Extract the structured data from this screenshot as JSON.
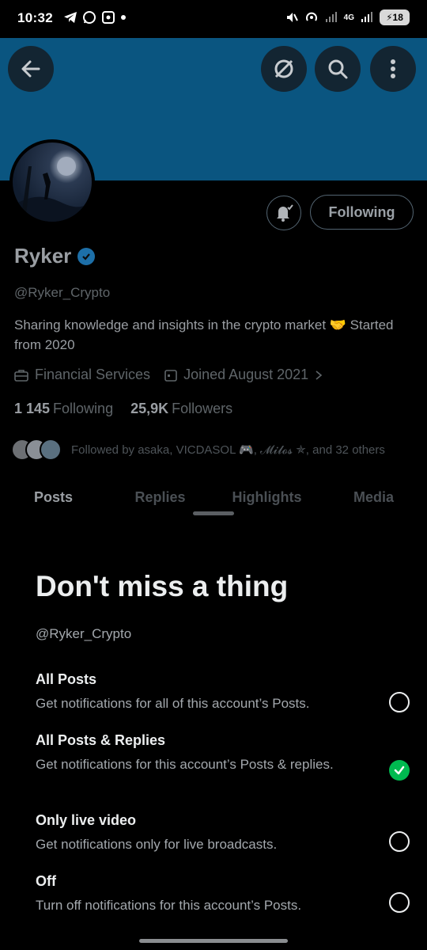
{
  "status_bar": {
    "time": "10:32",
    "battery": "18",
    "network": "4G"
  },
  "profile": {
    "name": "Ryker",
    "handle": "@Ryker_Crypto",
    "bio": "Sharing knowledge and insights in the crypto market 🤝 Started from 2020",
    "category": "Financial Services",
    "joined": "Joined August 2021",
    "following_count": "1 145",
    "following_label": "Following",
    "followers_count": "25,9K",
    "followers_label": "Followers",
    "followed_by": "Followed by asaka, VICDASOL 🎮, 𝓜𝓲𝓵𝓸𝓼 ✯, and 32 others",
    "follow_button": "Following"
  },
  "tabs": [
    "Posts",
    "Replies",
    "Highlights",
    "Media"
  ],
  "sheet": {
    "title": "Don't miss a thing",
    "handle": "@Ryker_Crypto",
    "options": [
      {
        "title": "All Posts",
        "desc": "Get notifications for all of this account’s Posts.",
        "selected": false
      },
      {
        "title": "All Posts & Replies",
        "desc": "Get notifications for this account’s Posts & replies.",
        "selected": true
      },
      {
        "title": "Only live video",
        "desc": "Get notifications only for live broadcasts.",
        "selected": false
      },
      {
        "title": "Off",
        "desc": "Turn off notifications for this account’s Posts.",
        "selected": false
      }
    ]
  },
  "colors": {
    "banner": "#0a5580",
    "accent_check": "#00ba50",
    "verified": "#1d9bf0"
  }
}
